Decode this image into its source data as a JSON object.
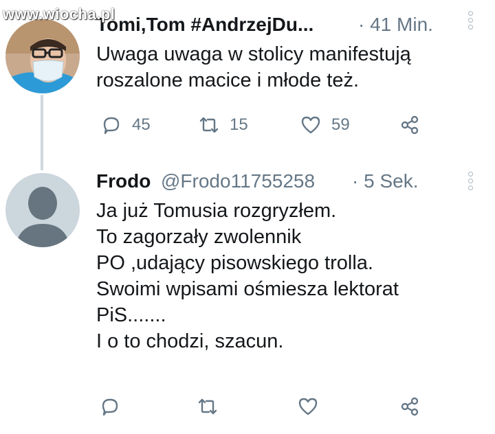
{
  "watermark": "www.wiocha.pl",
  "tweets": [
    {
      "author": "Tomi,Tom #AndrzejDu...",
      "handle": "",
      "time": "· 41 Min.",
      "text": "Uwaga uwaga w stolicy manifestują\nroszalone macice i młode też.",
      "actions": {
        "reply_count": "45",
        "retweet_count": "15",
        "like_count": "59"
      }
    },
    {
      "author": "Frodo",
      "handle": "@Frodo11755258",
      "time": "· 5 Sek.",
      "text": "Ja już Tomusia rozgryzłem.\nTo zagorzały zwolennik\nPO ,udający pisowskiego trolla.\nSwoimi wpisami ośmiesza lektorat\nPiS.......\nI o to chodzi, szacun.",
      "actions": {
        "reply_count": "",
        "retweet_count": "",
        "like_count": ""
      }
    }
  ],
  "icons": {
    "reply": "reply-icon",
    "retweet": "retweet-icon",
    "like": "heart-icon",
    "share": "share-icon",
    "more": "more-vertical-icon"
  },
  "colors": {
    "text": "#14171a",
    "secondary": "#657786",
    "thread_line": "#cfd9de",
    "default_avatar_bg": "#ccd6dd"
  }
}
